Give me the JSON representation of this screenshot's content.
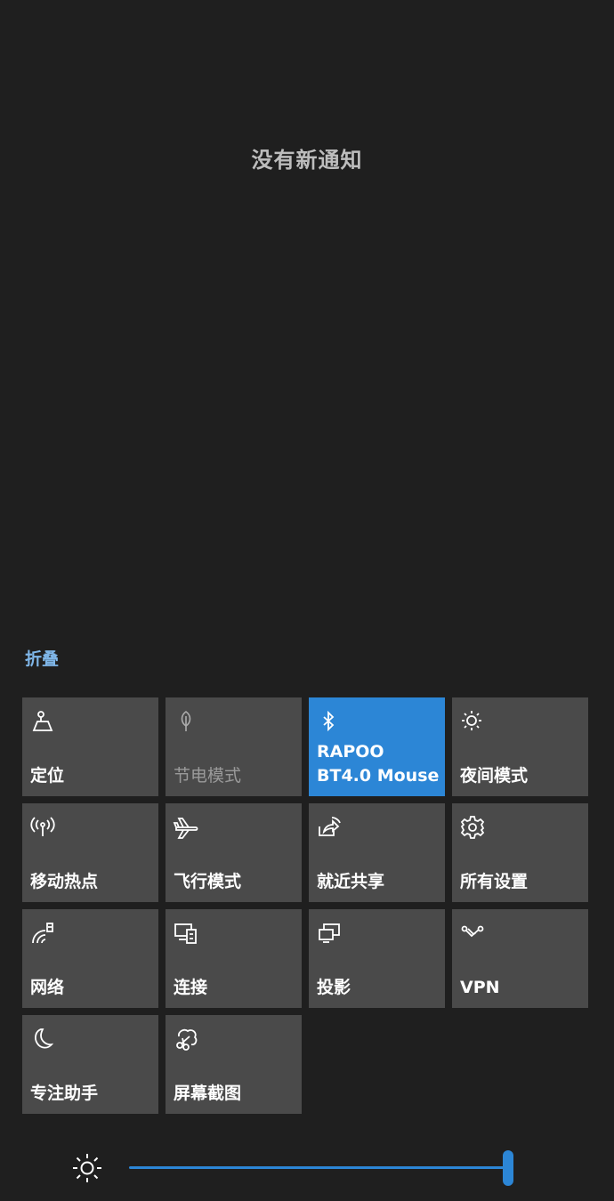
{
  "notifications": {
    "empty_text": "没有新通知"
  },
  "collapse_label": "折叠",
  "quick_actions": [
    {
      "label": "定位",
      "icon": "location-icon",
      "state": "off"
    },
    {
      "label": "节电模式",
      "icon": "battery-saver-icon",
      "state": "disabled"
    },
    {
      "label": "RAPOO BT4.0 Mouse",
      "icon": "bluetooth-icon",
      "state": "on"
    },
    {
      "label": "夜间模式",
      "icon": "night-light-icon",
      "state": "off"
    },
    {
      "label": "移动热点",
      "icon": "mobile-hotspot-icon",
      "state": "off"
    },
    {
      "label": "飞行模式",
      "icon": "airplane-icon",
      "state": "off"
    },
    {
      "label": "就近共享",
      "icon": "nearby-share-icon",
      "state": "off"
    },
    {
      "label": "所有设置",
      "icon": "settings-gear-icon",
      "state": "off"
    },
    {
      "label": "网络",
      "icon": "network-icon",
      "state": "off"
    },
    {
      "label": "连接",
      "icon": "connect-icon",
      "state": "off"
    },
    {
      "label": "投影",
      "icon": "project-icon",
      "state": "off"
    },
    {
      "label": "VPN",
      "icon": "vpn-icon",
      "state": "off"
    },
    {
      "label": "专注助手",
      "icon": "focus-assist-moon-icon",
      "state": "off"
    },
    {
      "label": "屏幕截图",
      "icon": "screen-snip-icon",
      "state": "off"
    }
  ],
  "brightness": {
    "icon": "brightness-sun-icon",
    "level": 1.0
  },
  "colors": {
    "background": "#1f1f1f",
    "tile": "#4a4a4a",
    "accent": "#2c86d6",
    "link": "#7fb6e8"
  }
}
